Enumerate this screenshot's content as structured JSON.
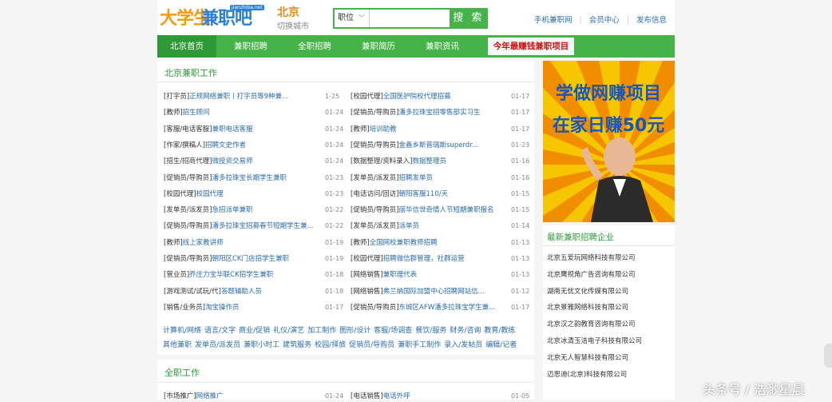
{
  "header": {
    "logo_text_1": "大学生",
    "logo_text_2": "兼职吧",
    "logo_domain": "jianzhiba.net",
    "city": "北京",
    "switch_city": "切换城市",
    "search_select": "职位",
    "search_placeholder": "",
    "search_button": "搜 索",
    "links": [
      "手机兼职网",
      "会员中心",
      "发布信息"
    ]
  },
  "nav": {
    "items": [
      "北京首页",
      "兼职招聘",
      "全职招聘",
      "兼职简历",
      "兼职资讯"
    ],
    "promo": "今年最赚钱兼职项目"
  },
  "parttime": {
    "title": "北京兼职工作",
    "left": [
      {
        "cat": "[打字员]",
        "title": "正规网络兼职丨打字员等9种兼...",
        "date": "1-25"
      },
      {
        "cat": "[教师]",
        "title": "招生顾问",
        "date": "01-24"
      },
      {
        "cat": "[客服/电话客服]",
        "title": "兼职电话客服",
        "date": "01-24"
      },
      {
        "cat": "[作家/撰稿人]",
        "title": "招聘文史作者",
        "date": "01-24"
      },
      {
        "cat": "[招生/招商代理]",
        "title": "微投资交易师",
        "date": "01-24"
      },
      {
        "cat": "[促销员/导购员]",
        "title": "潘多拉珠宝长期学生兼职",
        "date": "01-23"
      },
      {
        "cat": "[校园代理]",
        "title": "校园代理",
        "date": "01-23"
      },
      {
        "cat": "[发单员/派发员]",
        "title": "急招派单兼职",
        "date": "01-22"
      },
      {
        "cat": "[促销员/导购员]",
        "title": "潘多拉珠宝招募春节短期学生兼...",
        "date": "01-22"
      },
      {
        "cat": "[教师]",
        "title": "线上家教讲师",
        "date": "01-19"
      },
      {
        "cat": "[促销员/导购员]",
        "title": "朝阳区CK门店招学生兼职",
        "date": "01-19"
      },
      {
        "cat": "[营业员]",
        "title": "乔庄力宝华联CK招学生兼职",
        "date": "01-18"
      },
      {
        "cat": "[游戏测试/试玩/代]",
        "title": "答题辅助人员",
        "date": "01-18"
      },
      {
        "cat": "[销售/业务员]",
        "title": "淘宝操作员",
        "date": "01-17"
      }
    ],
    "right": [
      {
        "cat": "[校园代理]",
        "title": "全国医护院校代理招募",
        "date": "01-17"
      },
      {
        "cat": "[促销员/导购员]",
        "title": "潘多拉珠宝招零售部实习生",
        "date": "01-17"
      },
      {
        "cat": "[教师]",
        "title": "培训助教",
        "date": "01-17"
      },
      {
        "cat": "[促销员/导购员]",
        "title": "金鑫乡斯普瑞斯superdr...",
        "date": "01-23"
      },
      {
        "cat": "[数据整理/资料录入]",
        "title": "数据整理员",
        "date": "01-16"
      },
      {
        "cat": "[发单员/派发员]",
        "title": "招聘发单员",
        "date": "01-16"
      },
      {
        "cat": "[电话访问/回访]",
        "title": "朝阳客服110/天",
        "date": "01-15"
      },
      {
        "cat": "[促销员/导购员]",
        "title": "丽华信世奇情人节短期兼职报名",
        "date": "01-15"
      },
      {
        "cat": "[发单员/派发员]",
        "title": "派单员",
        "date": "01-14"
      },
      {
        "cat": "[教师]",
        "title": "全国网校兼职教师招聘",
        "date": "01-13"
      },
      {
        "cat": "[校园代理]",
        "title": "招聘微信群管理，社群运营",
        "date": "01-13"
      },
      {
        "cat": "[网络销售]",
        "title": "兼职理代表",
        "date": "01-13"
      },
      {
        "cat": "[网络销售]",
        "title": "弗兰纳国际加盟中心招聘网站信...",
        "date": "01-12"
      },
      {
        "cat": "[促销员/导购员]",
        "title": "东城区AFW潘多拉珠宝学生兼...",
        "date": "01-17"
      }
    ],
    "tags_line1": [
      "计算机/网络",
      "语言/文字",
      "商业/促销",
      "礼仪/演艺",
      "加工制作",
      "图形/设计",
      "客服/场调查",
      "餐饮/服务",
      "财务/咨询",
      "教育/教练"
    ],
    "tags_line2": [
      "其他兼职",
      "发单员/派发员",
      "兼职小时工",
      "建筑服务",
      "校园/择旅",
      "促销员/导购员",
      "兼职手工制作",
      "录入/发帖员",
      "编辑/记者"
    ]
  },
  "fulltime": {
    "title": "全职工作",
    "left": {
      "cat": "[市场推广]",
      "title": "网络推广",
      "date": "01-24"
    },
    "right": {
      "cat": "[电话销售]",
      "title": "电话外呼",
      "date": "01-05"
    }
  },
  "ad": {
    "line1": "学做网赚项目",
    "line2": "在家日赚50元",
    "colors": {
      "bg": "#f6c700",
      "ray": "#f08400",
      "text": "#1656b8"
    }
  },
  "companies": {
    "title": "最新兼职招聘企业",
    "items": [
      "北京五爱玩网络科技有限公司",
      "北京鹰视角广告咨询有限公司",
      "湖南无忧文化传媒有限公司",
      "北京景雅网络科技有限公司",
      "北京汉之韵教育咨询有限公司",
      "北京冰清玉洁电子科技有限公司",
      "北京无人智慧科技有限公司",
      "迈思迪(北京)科技有限公司"
    ]
  },
  "watermark": "头条号 / 浩渺星晨",
  "colors": {
    "accent": "#45b348",
    "link": "#2a6ab0",
    "promo": "#d01010"
  }
}
